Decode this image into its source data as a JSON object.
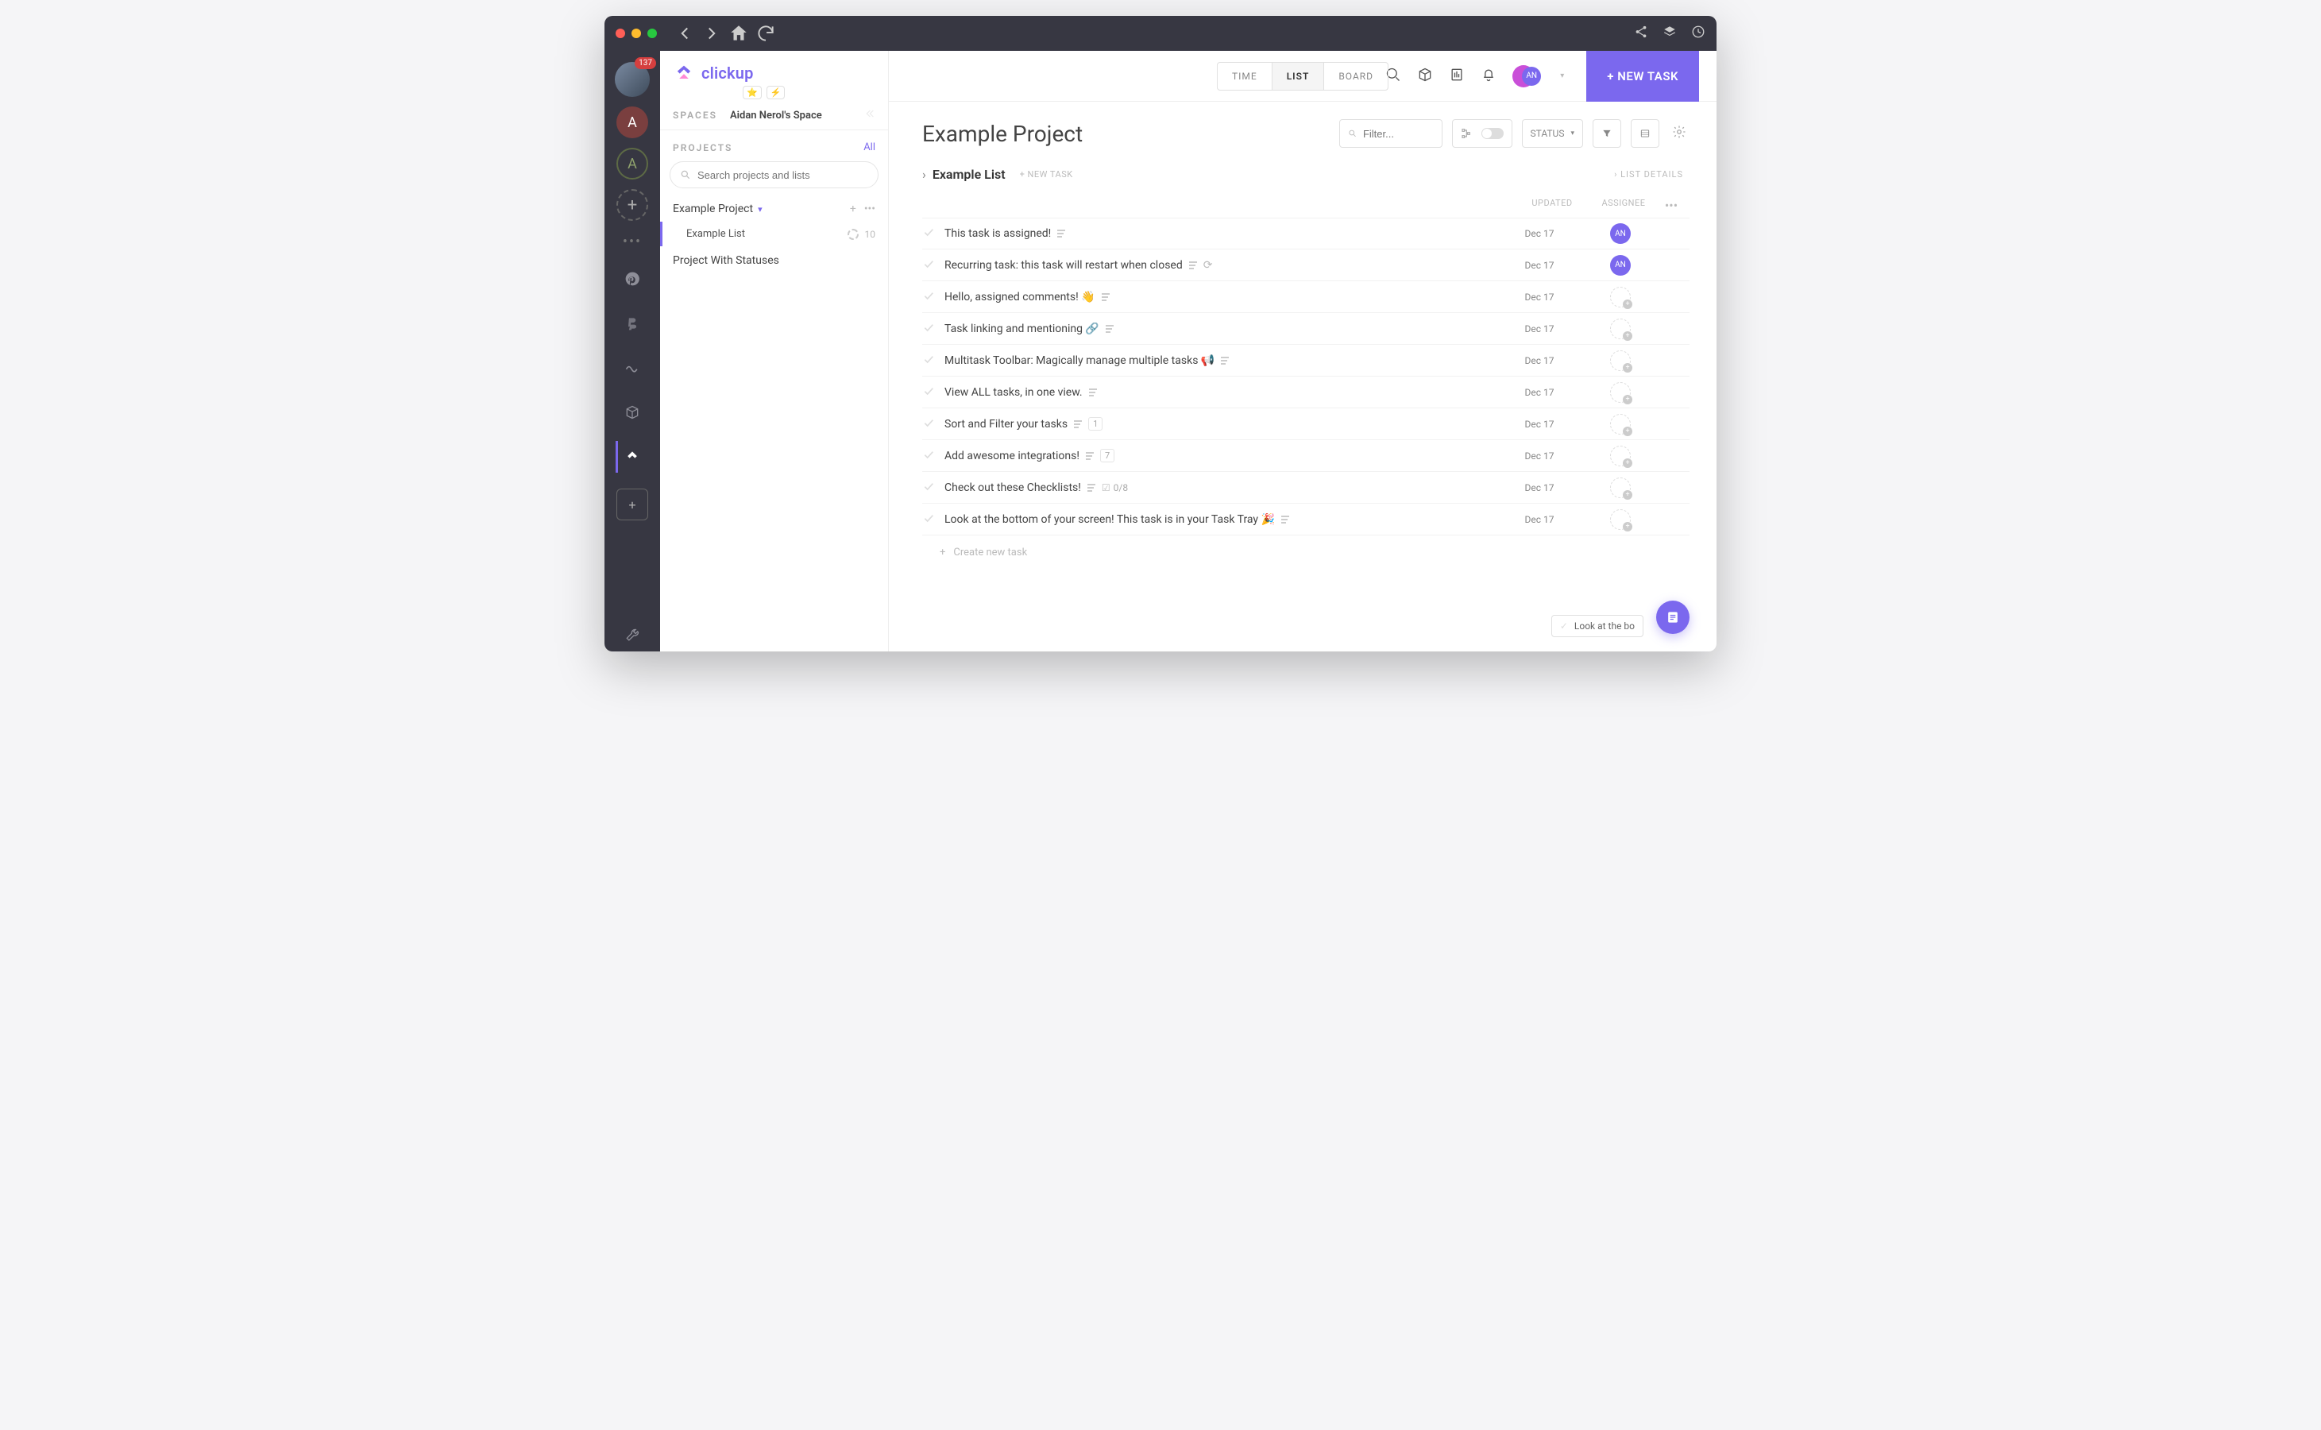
{
  "titlebar": {
    "badge_count": "137"
  },
  "brand": {
    "name": "clickup"
  },
  "sidebar": {
    "spaces_label": "SPACES",
    "space_name": "Aidan Nerol's Space",
    "projects_label": "PROJECTS",
    "all_link": "All",
    "search_placeholder": "Search projects and lists",
    "projects": [
      {
        "name": "Example Project",
        "expanded": true,
        "lists": [
          {
            "name": "Example List",
            "count": "10"
          }
        ]
      },
      {
        "name": "Project With Statuses"
      }
    ]
  },
  "topbar": {
    "tabs": [
      {
        "label": "TIME"
      },
      {
        "label": "LIST",
        "active": true
      },
      {
        "label": "BOARD"
      }
    ],
    "avatar_initials": "AN",
    "new_task": "+ NEW TASK"
  },
  "toolbar": {
    "project_title": "Example Project",
    "filter_placeholder": "Filter...",
    "status_label": "STATUS"
  },
  "list": {
    "name": "Example List",
    "new_task_label": "+ NEW TASK",
    "details_label": "› LIST DETAILS",
    "columns": {
      "updated": "UPDATED",
      "assignee": "ASSIGNEE"
    },
    "create_new": "Create new task",
    "tasks": [
      {
        "title": "This task is assigned!",
        "updated": "Dec 17",
        "assignee": "AN",
        "icons": [
          "desc"
        ]
      },
      {
        "title": "Recurring task: this task will restart when closed",
        "updated": "Dec 17",
        "assignee": "AN",
        "icons": [
          "desc",
          "recur"
        ]
      },
      {
        "title": "Hello, assigned comments! 👋",
        "updated": "Dec 17",
        "assignee": null,
        "icons": [
          "desc"
        ]
      },
      {
        "title": "Task linking and mentioning 🔗",
        "updated": "Dec 17",
        "assignee": null,
        "icons": [
          "desc"
        ]
      },
      {
        "title": "Multitask Toolbar: Magically manage multiple tasks 📢",
        "updated": "Dec 17",
        "assignee": null,
        "icons": [
          "desc"
        ]
      },
      {
        "title": "View ALL tasks, in one view.",
        "updated": "Dec 17",
        "assignee": null,
        "icons": [
          "desc"
        ]
      },
      {
        "title": "Sort and Filter your tasks",
        "updated": "Dec 17",
        "assignee": null,
        "icons": [
          "desc"
        ],
        "badge": "1"
      },
      {
        "title": "Add awesome integrations!",
        "updated": "Dec 17",
        "assignee": null,
        "icons": [
          "desc"
        ],
        "badge": "7"
      },
      {
        "title": "Check out these Checklists!",
        "updated": "Dec 17",
        "assignee": null,
        "icons": [
          "desc"
        ],
        "checklist": "0/8"
      },
      {
        "title": "Look at the bottom of your screen! This task is in your Task Tray 🎉",
        "updated": "Dec 17",
        "assignee": null,
        "icons": [
          "desc"
        ]
      }
    ]
  },
  "tray": {
    "text": "Look at the bo"
  },
  "rail": {
    "workspace_a1": "A",
    "workspace_a2": "A"
  }
}
